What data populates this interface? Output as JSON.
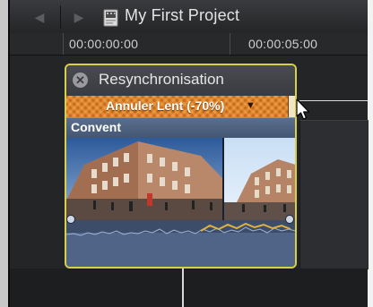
{
  "window": {
    "project_title": "My First Project"
  },
  "toolbar": {
    "back_icon": "back-arrow-icon",
    "forward_icon": "forward-arrow-icon",
    "project_icon": "film-document-icon"
  },
  "ruler": {
    "timecodes": [
      "00:00:00:00",
      "00:00:05:00"
    ]
  },
  "retime_popover": {
    "title": "Resynchronisation",
    "speed_label": "Annuler Lent (-70%)",
    "speed_bar_color": "#c96a1c",
    "border_color": "#d8d04a"
  },
  "clip": {
    "name": "Convent",
    "header_color": "#5a6f8d",
    "audio_color": "#4f6487"
  }
}
